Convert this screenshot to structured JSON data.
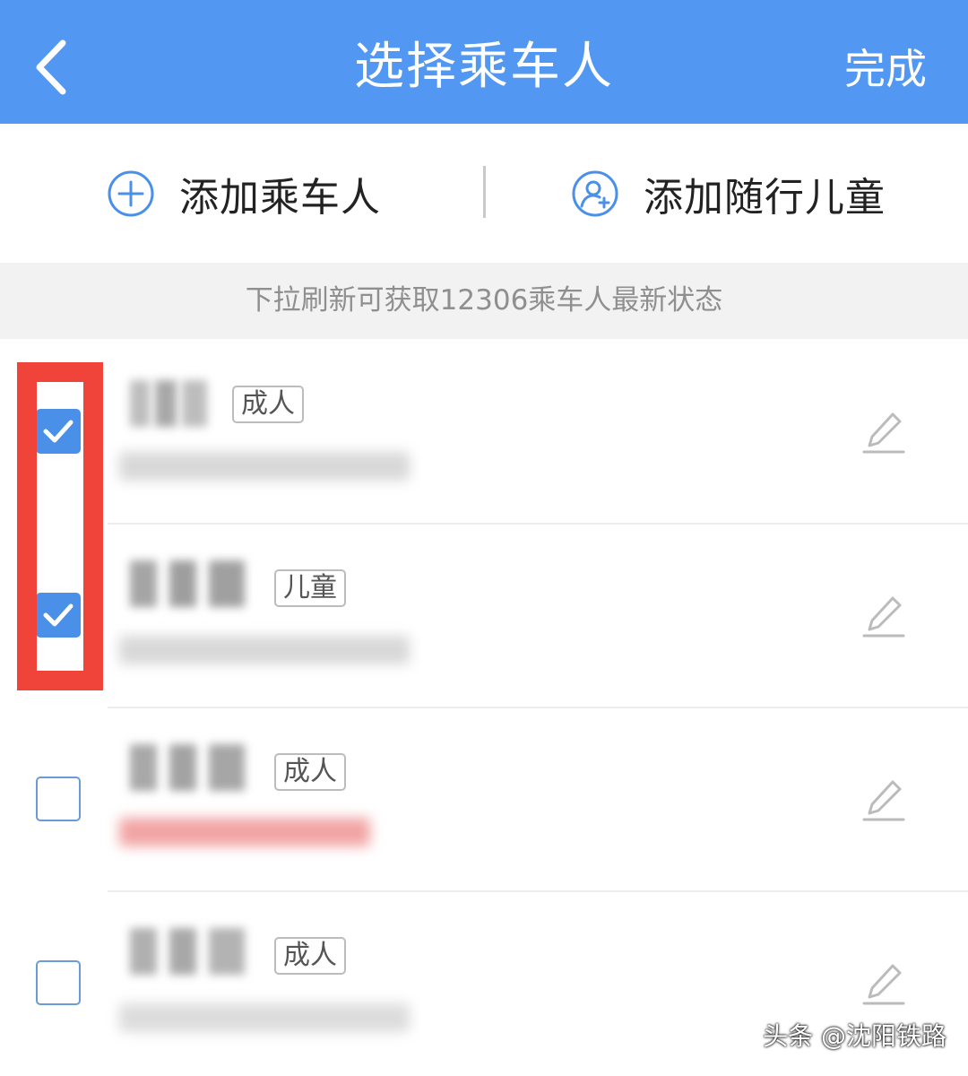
{
  "header": {
    "title": "选择乘车人",
    "done_label": "完成"
  },
  "actions": {
    "add_passenger": "添加乘车人",
    "add_child": "添加随行儿童"
  },
  "hint": "下拉刷新可获取12306乘车人最新状态",
  "passengers": [
    {
      "type": "成人",
      "checked": true
    },
    {
      "type": "儿童",
      "checked": true
    },
    {
      "type": "成人",
      "checked": false
    },
    {
      "type": "成人",
      "checked": false
    }
  ],
  "colors": {
    "header_bg": "#5298f2",
    "checkbox_checked": "#4a90e8",
    "highlight_border": "#f0443a",
    "invalid_id_text": "#f08a8a"
  },
  "watermark": "头条 @沈阳铁路"
}
